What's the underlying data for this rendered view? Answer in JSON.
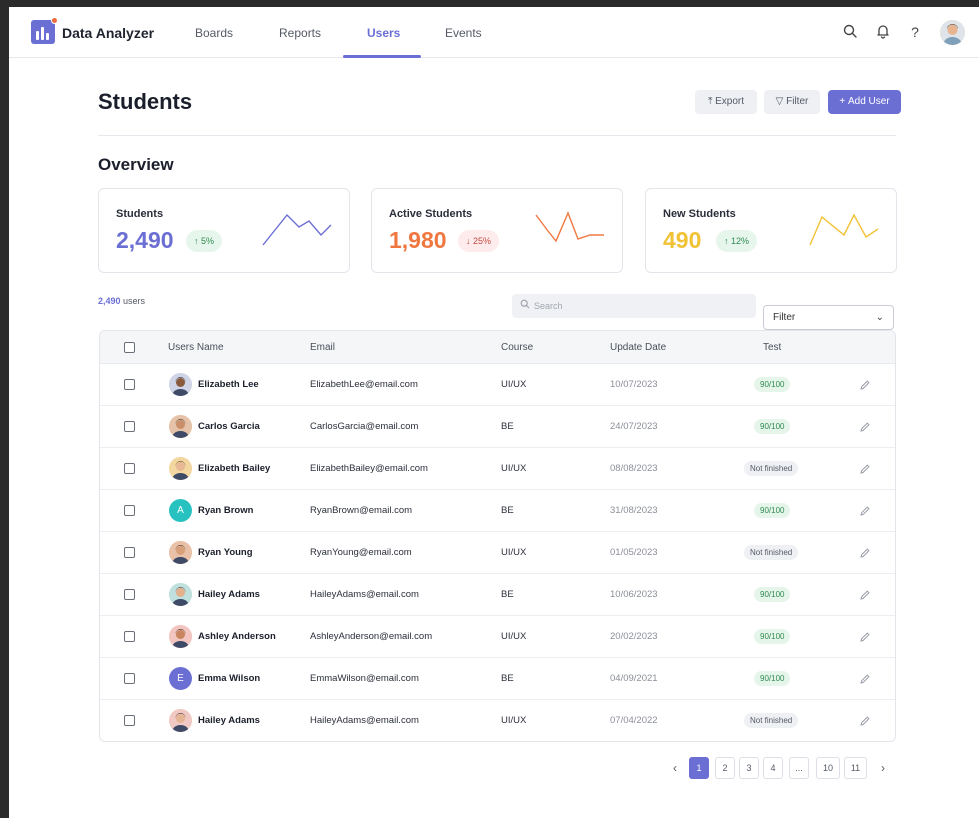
{
  "app": {
    "brand": "Data Analyzer",
    "accent": "#6b6fd4",
    "tabs": [
      {
        "label": "Boards",
        "active": false
      },
      {
        "label": "Reports",
        "active": false
      },
      {
        "label": "Users",
        "active": true
      },
      {
        "label": "Events",
        "active": false
      }
    ],
    "icons": [
      "search-icon",
      "bell-icon",
      "help-icon",
      "user-avatar"
    ]
  },
  "header": {
    "title": "Students",
    "export_label": "Export",
    "filter_label": "Filter",
    "add_user_label": "Add User"
  },
  "overview": {
    "title": "Overview",
    "cards": [
      {
        "label": "Students",
        "value": "2,490",
        "delta": "5%",
        "direction": "up",
        "color": "#6b6fd4"
      },
      {
        "label": "Active Students",
        "value": "1,980",
        "delta": "25%",
        "direction": "down",
        "color": "#f07840"
      },
      {
        "label": "New Students",
        "value": "490",
        "delta": "12%",
        "direction": "up",
        "color": "#f2c236"
      }
    ]
  },
  "list": {
    "count": "2,490",
    "count_suffix": "users",
    "search_placeholder": "Search",
    "filter_value": "Filter"
  },
  "table": {
    "columns": [
      "Users Name",
      "Email",
      "Course",
      "Update Date",
      "Test"
    ],
    "rows": [
      {
        "name": "Elizabeth Lee",
        "email": "ElizabethLee@email.com",
        "course": "UI/UX",
        "date": "10/07/2023",
        "test": "90/100",
        "avatar": "photo"
      },
      {
        "name": "Carlos Garcia",
        "email": "CarlosGarcia@email.com",
        "course": "BE",
        "date": "24/07/2023",
        "test": "90/100",
        "avatar": "photo"
      },
      {
        "name": "Elizabeth Bailey",
        "email": "ElizabethBailey@email.com",
        "course": "UI/UX",
        "date": "08/08/2023",
        "test": "Not finished",
        "avatar": "photo"
      },
      {
        "name": "Ryan Brown",
        "email": "RyanBrown@email.com",
        "course": "BE",
        "date": "31/08/2023",
        "test": "90/100",
        "avatar": "A"
      },
      {
        "name": "Ryan Young",
        "email": "RyanYoung@email.com",
        "course": "UI/UX",
        "date": "01/05/2023",
        "test": "Not finished",
        "avatar": "photo"
      },
      {
        "name": "Hailey Adams",
        "email": "HaileyAdams@email.com",
        "course": "BE",
        "date": "10/06/2023",
        "test": "90/100",
        "avatar": "photo"
      },
      {
        "name": "Ashley Anderson",
        "email": "AshleyAnderson@email.com",
        "course": "UI/UX",
        "date": "20/02/2023",
        "test": "90/100",
        "avatar": "photo"
      },
      {
        "name": "Emma Wilson",
        "email": "EmmaWilson@email.com",
        "course": "BE",
        "date": "04/09/2021",
        "test": "90/100",
        "avatar": "E"
      },
      {
        "name": "Hailey Adams",
        "email": "HaileyAdams@email.com",
        "course": "UI/UX",
        "date": "07/04/2022",
        "test": "Not finished",
        "avatar": "photo"
      }
    ]
  },
  "pagination": {
    "pages": [
      "1",
      "2",
      "3",
      "4",
      "...",
      "10",
      "11"
    ],
    "current": "1"
  }
}
